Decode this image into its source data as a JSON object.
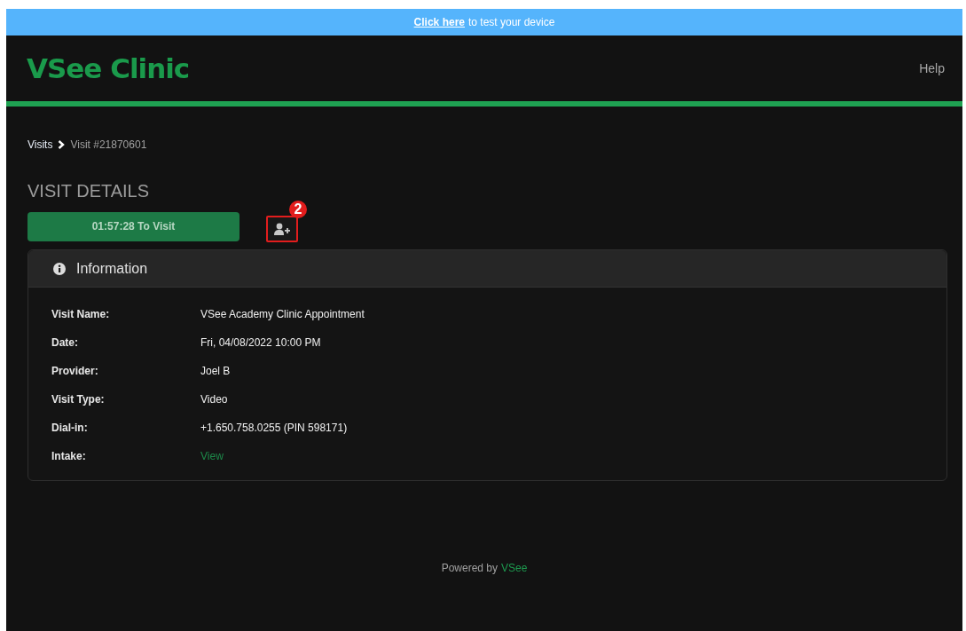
{
  "banner": {
    "link": "Click here",
    "text": "to test your device"
  },
  "header": {
    "logo": "VSee Clinic",
    "help": "Help"
  },
  "breadcrumb": {
    "parent": "Visits",
    "current": "Visit #21870601"
  },
  "heading": "VISIT DETAILS",
  "visit_button": "01:57:28 To Visit",
  "annotation": {
    "badge": "2"
  },
  "card": {
    "title": "Information",
    "rows": [
      {
        "label": "Visit Name:",
        "value": "VSee Academy Clinic Appointment",
        "kind": "text"
      },
      {
        "label": "Date:",
        "value": "Fri, 04/08/2022 10:00 PM",
        "kind": "text"
      },
      {
        "label": "Provider:",
        "value": "Joel B",
        "kind": "text"
      },
      {
        "label": "Visit Type:",
        "value": "Video",
        "kind": "text"
      },
      {
        "label": "Dial-in:",
        "value": "+1.650.758.0255 (PIN 598171)",
        "kind": "text"
      },
      {
        "label": "Intake:",
        "value": "View",
        "kind": "link"
      }
    ]
  },
  "footer": {
    "text": "Powered by",
    "link": "VSee"
  }
}
